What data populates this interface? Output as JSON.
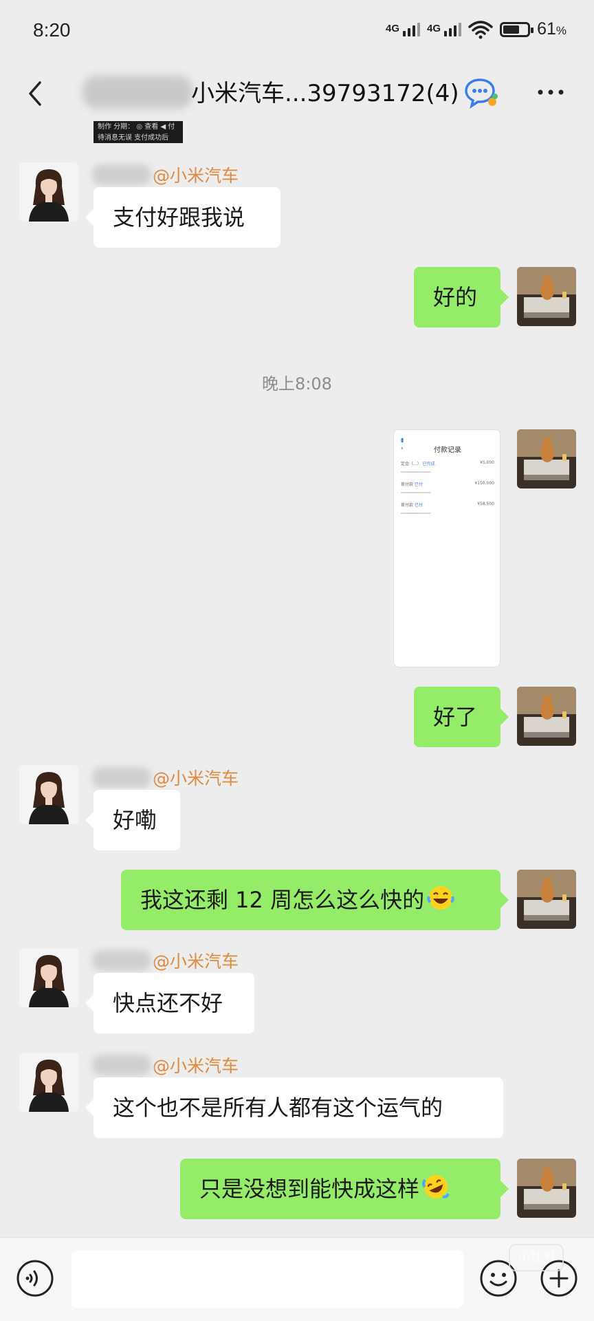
{
  "status_bar": {
    "time": "8:20",
    "network_1": "4G",
    "network_2": "4G",
    "battery": "61",
    "battery_unit": "%",
    "battery_level": 0.61
  },
  "header": {
    "title": "小米汽车...39793172(4)",
    "back_icon": "chevron-left-icon",
    "chat_icon": "group-chat-icon",
    "more_icon": "more-dots-icon"
  },
  "top_strip": {
    "line1": "制作 分期：    ◎ 查看 ◀ 付",
    "line2": "待消息无误      支付成功后"
  },
  "messages": [
    {
      "side": "left",
      "sender": "@小米汽车",
      "text": "支付好跟我说"
    },
    {
      "side": "right",
      "text": "好的"
    },
    {
      "type": "time",
      "text": "晚上8:08"
    },
    {
      "side": "right",
      "type": "image",
      "title": "付款记录"
    },
    {
      "side": "right",
      "text": "好了"
    },
    {
      "side": "left",
      "sender": "@小米汽车",
      "text": "好嘞"
    },
    {
      "side": "right",
      "text": "我这还剩 12 周怎么这么快的",
      "emoji": "laughing-tears"
    },
    {
      "side": "left",
      "sender": "@小米汽车",
      "text": "快点还不好"
    },
    {
      "side": "left",
      "sender": "@小米汽车",
      "text": "这个也不是所有人都有这个运气的"
    },
    {
      "side": "right",
      "text": "只是没想到能快成这样",
      "emoji": "rolling-laughing"
    }
  ],
  "screenshot_content": {
    "title": "付款记录",
    "rows": [
      {
        "label": "定金（...）",
        "tag": "已完成",
        "amount": "¥5,000"
      },
      {
        "label": "首付款",
        "tag": "已付",
        "amount": "¥150,000"
      },
      {
        "label": "首付款",
        "tag": "已付",
        "amount": "¥58,500"
      }
    ]
  },
  "input_bar": {
    "voice_icon": "voice-icon",
    "emoji_icon": "smiley-icon",
    "plus_icon": "plus-icon",
    "watermark": "小红书号：",
    "watermark_logo": "小红书"
  },
  "colors": {
    "background": "#ededed",
    "bubble_right": "#95ec69",
    "bubble_left": "#ffffff",
    "sender_name": "#e08a3d"
  }
}
